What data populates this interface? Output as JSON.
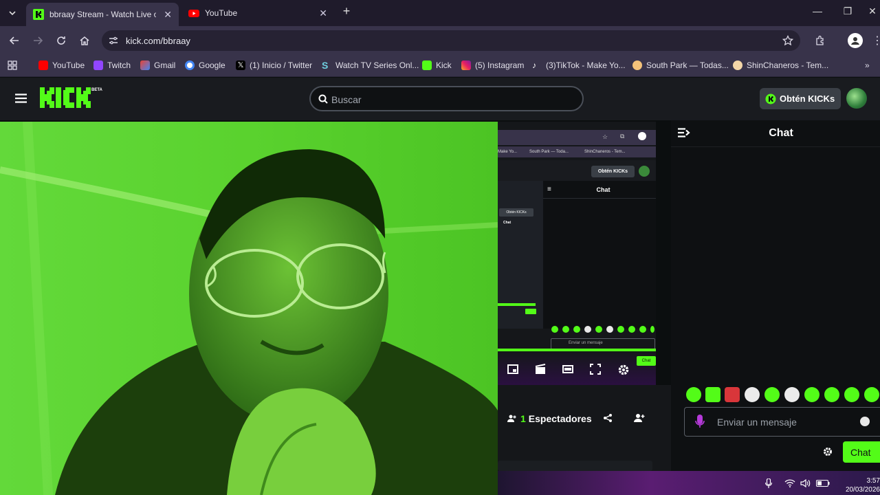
{
  "browser": {
    "tabs": [
      {
        "title": "bbraay Stream - Watch Live on",
        "active": true,
        "icon": "kick-favicon"
      },
      {
        "title": "YouTube",
        "active": false,
        "icon": "youtube-favicon"
      }
    ],
    "new_tab_label": "+",
    "url": "kick.com/bbraay",
    "bookmarks": [
      {
        "label": "YouTube",
        "icon": "youtube-icon"
      },
      {
        "label": "Twitch",
        "icon": "twitch-icon"
      },
      {
        "label": "Gmail",
        "icon": "gmail-icon"
      },
      {
        "label": "Google",
        "icon": "google-icon"
      },
      {
        "label": "(1) Inicio / Twitter",
        "icon": "x-icon"
      },
      {
        "label": "Watch TV Series Onl...",
        "icon": "s-icon"
      },
      {
        "label": "Kick",
        "icon": "kick-icon"
      },
      {
        "label": "(5) Instagram",
        "icon": "instagram-icon"
      },
      {
        "label": "(3)TikTok - Make Yo...",
        "icon": "tiktok-icon"
      },
      {
        "label": "South Park — Todas...",
        "icon": "southpark-icon"
      },
      {
        "label": "ShinChaneros - Tem...",
        "icon": "shinchan-icon"
      }
    ]
  },
  "kick": {
    "logo": "KICK",
    "beta": "BETA",
    "search_placeholder": "Buscar",
    "get_kicks_label": "Obtén KICKs",
    "accent": "#53fc18"
  },
  "preview": {
    "get_kicks_label": "Obtén KICKs",
    "chat_title": "Chat",
    "mini_kicks": "Obtén KICKs",
    "mini_chat": "Chat",
    "message_placeholder": "Enviar un mensaje",
    "chat_button": "Chat",
    "bookmarks": [
      "Make Yo...",
      "South Park — Toda...",
      "ShinChaneros - Tem..."
    ]
  },
  "stream_info": {
    "viewer_count": "1",
    "viewer_label": "Espectadores"
  },
  "chat": {
    "title": "Chat",
    "input_placeholder": "Enviar un mensaje",
    "send_label": "Chat"
  },
  "taskbar": {
    "time": "3:57",
    "date": "20/03/2026"
  }
}
